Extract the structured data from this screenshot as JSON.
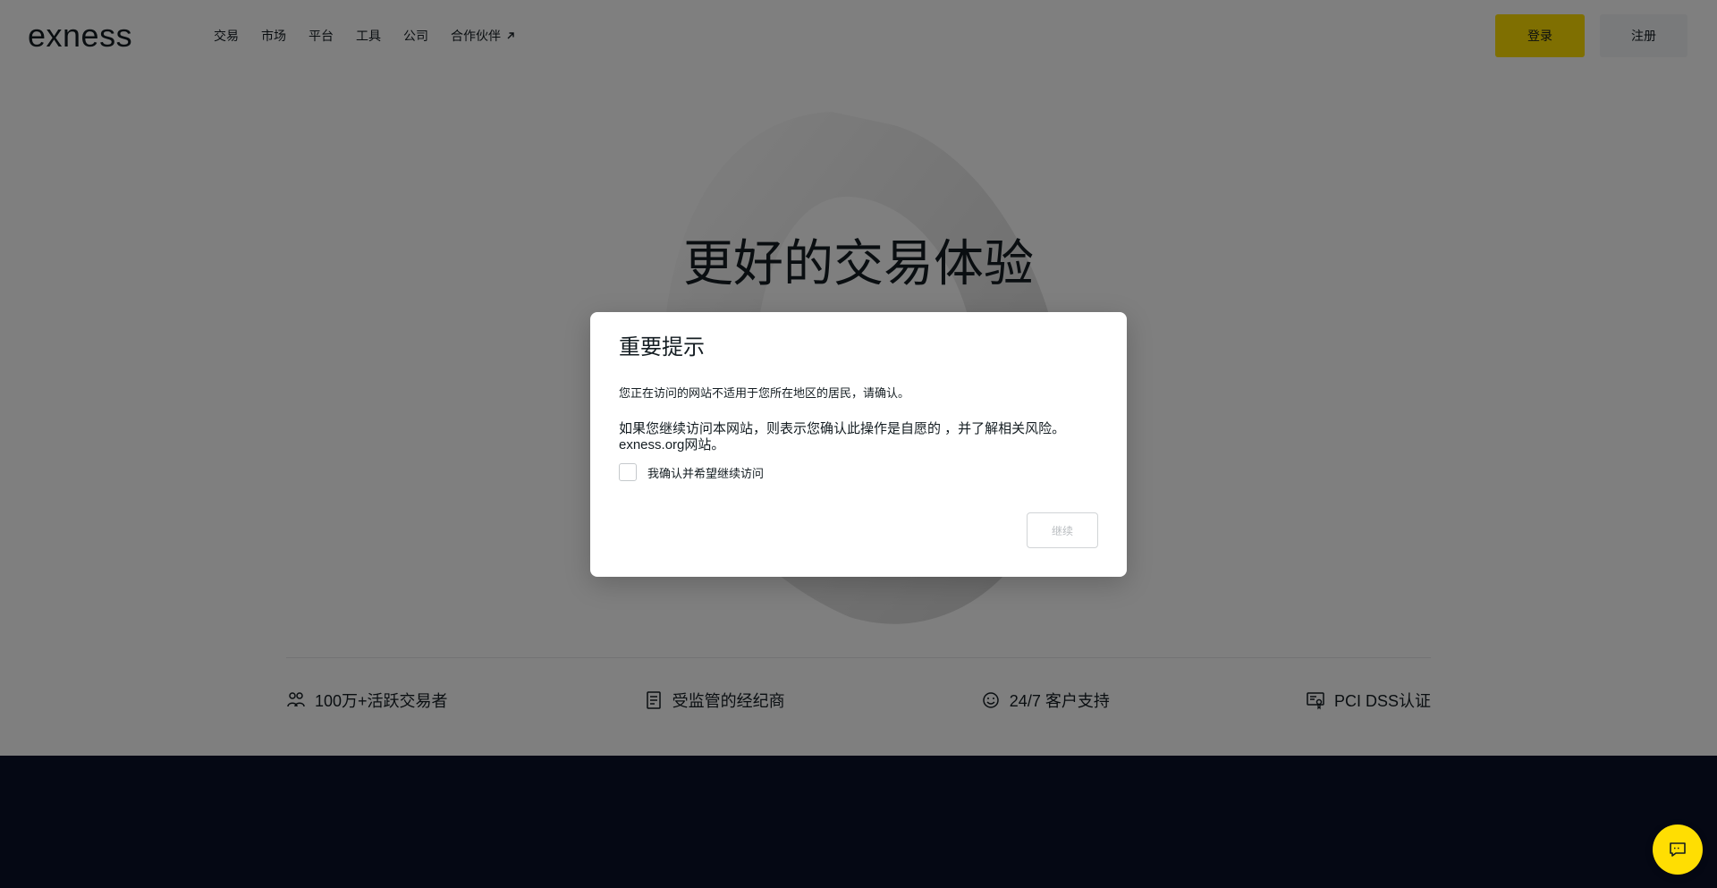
{
  "header": {
    "logo": "exness",
    "nav": [
      {
        "label": "交易"
      },
      {
        "label": "市场"
      },
      {
        "label": "平台"
      },
      {
        "label": "工具"
      },
      {
        "label": "公司"
      },
      {
        "label": "合作伙伴"
      }
    ],
    "signin_label": "登录",
    "register_label": "注册"
  },
  "hero": {
    "title": "更好的交易体验"
  },
  "features": [
    {
      "icon": "people-icon",
      "label": "100万+活跃交易者"
    },
    {
      "icon": "license-icon",
      "label": "受监管的经纪商"
    },
    {
      "icon": "support-icon",
      "label": "24/7 客户支持"
    },
    {
      "icon": "certificate-icon",
      "label": "PCI DSS认证"
    }
  ],
  "modal": {
    "title": "重要提示",
    "line1": "您正在访问的网站不适用于您所在地区的居民，请确认。",
    "line2": "如果您继续访问本网站，则表示您确认此操作是自愿的 ，并了解相关风险。exness.org网站。",
    "checkbox_label": "我确认并希望继续访问",
    "continue_label": "继续"
  },
  "colors": {
    "accent": "#ffde02",
    "dark_footer": "#0a1029",
    "text": "#141d22"
  }
}
